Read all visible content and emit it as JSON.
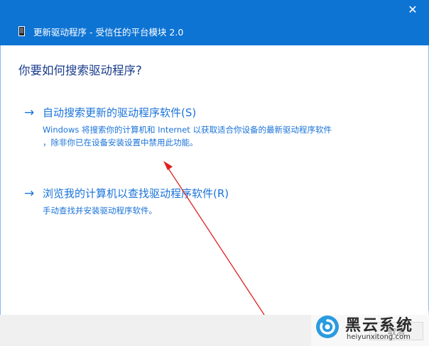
{
  "window": {
    "title": "更新驱动程序 - 受信任的平台模块 2.0",
    "close_glyph": "✕"
  },
  "main": {
    "question": "你要如何搜索驱动程序?",
    "options": [
      {
        "arrow": "→",
        "label": "自动搜索更新的驱动程序软件(S)",
        "description": "Windows 将搜索你的计算机和 Internet 以获取适合你设备的最新驱动程序软件\n，除非你已在设备安装设置中禁用此功能。"
      },
      {
        "arrow": "→",
        "label": "浏览我的计算机以查找驱动程序软件(R)",
        "description": "手动查找并安装驱动程序软件。"
      }
    ]
  },
  "footer": {
    "cancel_label": "取消"
  },
  "watermark": {
    "brand": "黑云系统",
    "url": "heiyunxitong.com"
  },
  "colors": {
    "titlebar": "#0e74d4",
    "heading": "#1a3c8c",
    "link": "#1a73d9",
    "annotation_arrow": "#e02020",
    "footer_bg": "#f0f0f0"
  },
  "icons": {
    "window_icon": "device-icon",
    "close": "close-icon",
    "option_arrow": "arrow-right-icon",
    "watermark_logo": "swirl-logo-icon"
  }
}
